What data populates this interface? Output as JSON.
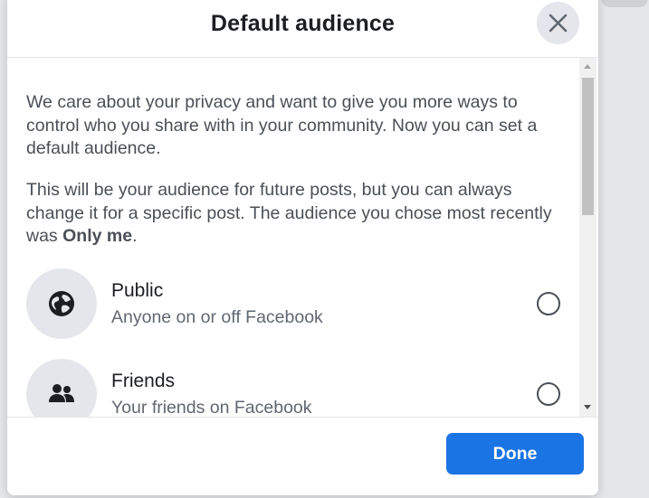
{
  "dialog": {
    "title": "Default audience",
    "close_icon": "close-icon"
  },
  "content": {
    "paragraph1": "We care about your privacy and want to give you more ways to control who you share with in your community. Now you can set a default audience.",
    "paragraph2_prefix": "This will be your audience for future posts, but you can always change it for a specific post. The audience you chose most recently was ",
    "paragraph2_bold": "Only me",
    "paragraph2_suffix": ".",
    "options": [
      {
        "title": "Public",
        "subtitle": "Anyone on or off Facebook",
        "icon": "globe-icon",
        "selected": false
      },
      {
        "title": "Friends",
        "subtitle": "Your friends on Facebook",
        "icon": "friends-icon",
        "selected": false
      }
    ]
  },
  "footer": {
    "done_label": "Done"
  },
  "colors": {
    "accent": "#1b74e4",
    "icon_bg": "#e4e6eb"
  }
}
